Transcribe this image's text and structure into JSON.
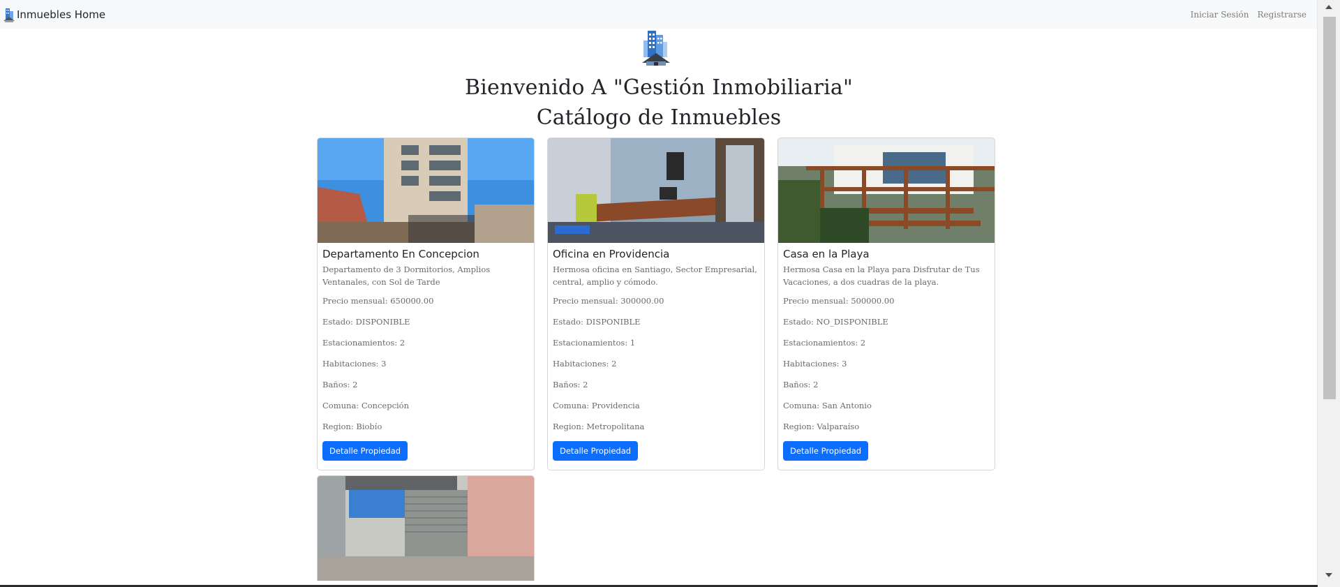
{
  "navbar": {
    "brand": "Inmuebles Home",
    "links": [
      "Iniciar Sesión",
      "Registrarse"
    ]
  },
  "hero": {
    "title": "Bienvenido A \"Gestión Inmobiliaria\"",
    "subtitle": "Catálogo de Inmuebles"
  },
  "cards": [
    {
      "title": "Departamento En Concepcion",
      "description": "Departamento de 3 Dormitorios, Amplios Ventanales, con Sol de Tarde",
      "price": "Precio mensual: 650000.00",
      "status": "Estado: DISPONIBLE",
      "parking": "Estacionamientos: 2",
      "rooms": "Habitaciones: 3",
      "baths": "Baños: 2",
      "commune": "Comuna: Concepción",
      "region": "Region: Biobío",
      "button": "Detalle Propiedad"
    },
    {
      "title": "Oficina en Providencia",
      "description": "Hermosa oficina en Santiago, Sector Empresarial, central, amplio y cómodo.",
      "price": "Precio mensual: 300000.00",
      "status": "Estado: DISPONIBLE",
      "parking": "Estacionamientos: 1",
      "rooms": "Habitaciones: 2",
      "baths": "Baños: 2",
      "commune": "Comuna: Providencia",
      "region": "Region: Metropolitana",
      "button": "Detalle Propiedad"
    },
    {
      "title": "Casa en la Playa",
      "description": "Hermosa Casa en la Playa para Disfrutar de Tus Vacaciones, a dos cuadras de la playa.",
      "price": "Precio mensual: 500000.00",
      "status": "Estado: NO_DISPONIBLE",
      "parking": "Estacionamientos: 2",
      "rooms": "Habitaciones: 3",
      "baths": "Baños: 2",
      "commune": "Comuna: San Antonio",
      "region": "Region: Valparaíso",
      "button": "Detalle Propiedad"
    }
  ],
  "icons": {
    "brand": "building-logo-icon",
    "hero": "building-logo-icon"
  },
  "colors": {
    "primary": "#0d6efd",
    "navbar": "#f8f9fa"
  }
}
